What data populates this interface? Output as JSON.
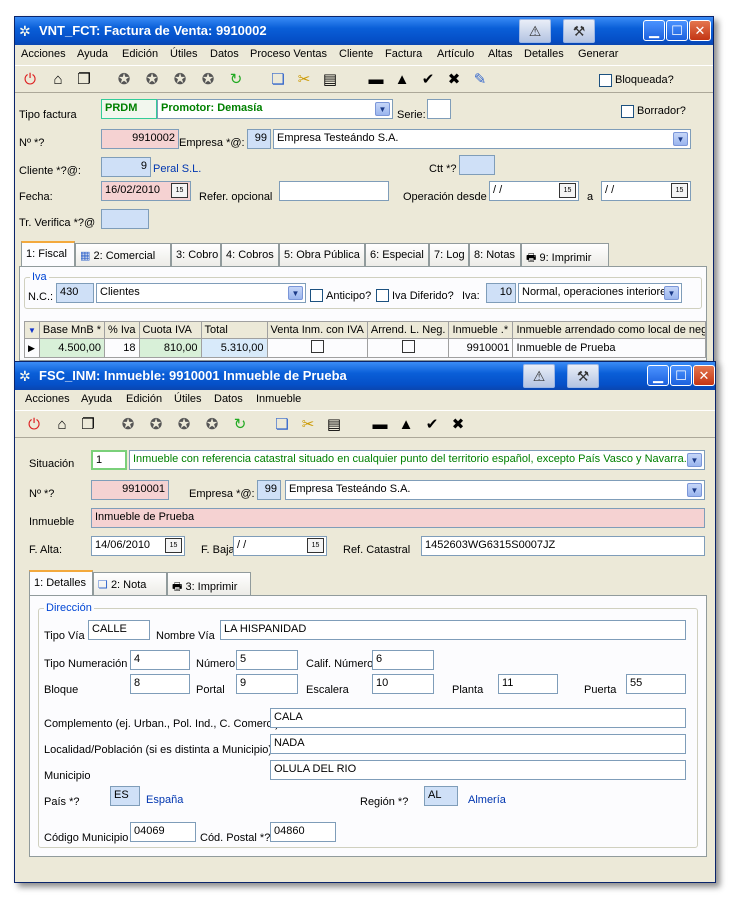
{
  "win1": {
    "title": "VNT_FCT: Factura de Venta: 9910002",
    "menu": [
      "Acciones",
      "Ayuda",
      "Edición",
      "Útiles",
      "Datos",
      "Proceso Ventas",
      "Cliente",
      "Factura",
      "Artículo",
      "Altas",
      "Detalles",
      "Generar"
    ],
    "bloqueada_label": "Bloqueada?",
    "tipo_factura_label": "Tipo factura",
    "tipo_factura_code": "PRDM",
    "tipo_factura_value": "Promotor: Demasía",
    "serie_label": "Serie:",
    "borrador_label": "Borrador?",
    "num_label": "Nº *?",
    "num_value": "9910002",
    "empresa_label": "Empresa *@:",
    "empresa_code": "99",
    "empresa_name": "Empresa Testeándo S.A.",
    "cliente_label": "Cliente *?@:",
    "cliente_code": "9",
    "cliente_name": "Peral S.L.",
    "ctt_label": "Ctt *?",
    "fecha_label": "Fecha:",
    "fecha_value": "16/02/2010",
    "refer_label": "Refer. opcional",
    "operacion_label": "Operación desde",
    "fecha_desde": " / /",
    "a_label": "a",
    "fecha_hasta": " / /",
    "tr_verifica_label": "Tr. Verifica *?@",
    "tabs": [
      "1: Fiscal",
      "2: Comercial",
      "3: Cobro",
      "4: Cobros",
      "5: Obra Pública",
      "6: Especial",
      "7: Log",
      "8: Notas",
      "9: Imprimir"
    ],
    "iva_group": "Iva",
    "nc_label": "N.C.:",
    "nc_code": "430",
    "nc_name": "Clientes",
    "anticipo_label": "Anticipo?",
    "iva_diferido_label": "Iva Diferido?",
    "iva_label": "Iva:",
    "iva_code": "10",
    "iva_name": "Normal, operaciones interiores",
    "grid_headers": [
      "Base MnB *",
      "% Iva",
      "Cuota IVA",
      "Total",
      "Venta Inm. con IVA",
      "Arrend. L. Neg.",
      "Inmueble .*",
      "Inmueble arrendado como local de negocio"
    ],
    "grid_row": {
      "base": "4.500,00",
      "iva": "18",
      "cuota": "810,00",
      "total": "5.310,00",
      "inmueble": "9910001",
      "desc": "Inmueble de Prueba"
    }
  },
  "win2": {
    "title": "FSC_INM: Inmueble: 9910001 Inmueble de Prueba",
    "menu": [
      "Acciones",
      "Ayuda",
      "Edición",
      "Útiles",
      "Datos",
      "Inmueble"
    ],
    "situacion_label": "Situación",
    "situacion_code": "1",
    "situacion_value": "Inmueble con referencia catastral situado en cualquier punto del territorio español, excepto País Vasco y Navarra.",
    "num_label": "Nº *?",
    "num_value": "9910001",
    "empresa_label": "Empresa *@:",
    "empresa_code": "99",
    "empresa_name": "Empresa Testeándo S.A.",
    "inmueble_label": "Inmueble",
    "inmueble_value": "Inmueble de Prueba",
    "falta_label": "F. Alta:",
    "falta_value": "14/06/2010",
    "fbaja_label": "F. Baja:",
    "fbaja_value": " / /",
    "refcat_label": "Ref. Catastral",
    "refcat_value": "1452603WG6315S0007JZ",
    "tabs": [
      "1: Detalles",
      "2: Nota",
      "3: Imprimir"
    ],
    "direccion_group": "Dirección",
    "tipo_via_label": "Tipo Vía",
    "tipo_via_value": "CALLE",
    "nombre_via_label": "Nombre Vía",
    "nombre_via_value": "LA HISPANIDAD",
    "tipo_num_label": "Tipo Numeración",
    "tipo_num_value": "4",
    "numero_label": "Número",
    "numero_value": "5",
    "calif_label": "Calif. Número",
    "calif_value": "6",
    "bloque_label": "Bloque",
    "bloque_value": "8",
    "portal_label": "Portal",
    "portal_value": "9",
    "escalera_label": "Escalera",
    "escalera_value": "10",
    "planta_label": "Planta",
    "planta_value": "11",
    "puerta_label": "Puerta",
    "puerta_value": "55",
    "complemento_label": "Complemento (ej. Urban., Pol. Ind., C. Comerc.)",
    "complemento_value": "CALA",
    "localidad_label": "Localidad/Población (si es distinta a Municipio)",
    "localidad_value": "NADA",
    "municipio_label": "Municipio",
    "municipio_value": "OLULA DEL RIO",
    "pais_label": "País *?",
    "pais_code": "ES",
    "pais_name": "España",
    "region_label": "Región *?",
    "region_code": "AL",
    "region_name": "Almería",
    "cod_muni_label": "Código Municipio",
    "cod_muni_value": "04069",
    "cod_postal_label": "Cód. Postal *?",
    "cod_postal_value": "04860"
  }
}
